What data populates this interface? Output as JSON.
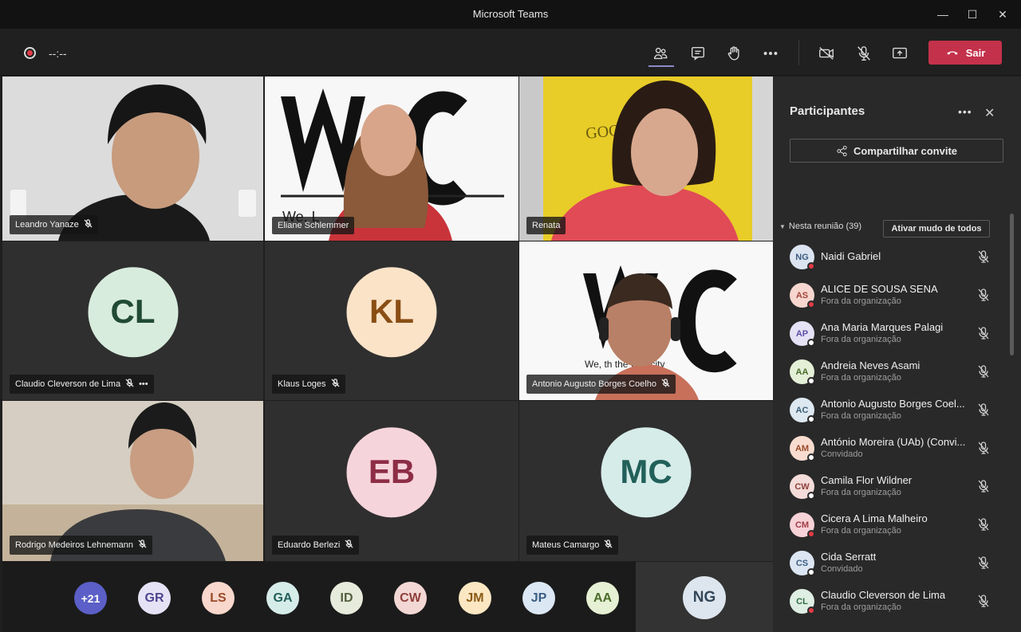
{
  "window": {
    "title": "Microsoft Teams",
    "minimize": "—",
    "maximize": "☐",
    "close": "✕"
  },
  "toolbar": {
    "timer": "--:--",
    "leave_label": "Sair"
  },
  "tiles": {
    "t1": "Leandro Yanaze",
    "t2": "Eliane Schlemmer",
    "t3": "Renata",
    "t4": "Claudio Cleverson de Lima",
    "t4_more": "•••",
    "t4_initials": "CL",
    "t5": "Klaus Loges",
    "t5_initials": "KL",
    "t6": "Antonio Augusto Borges Coelho",
    "t7": "Rodrigo Medeiros Lehnemann",
    "t8": "Eduardo Berlezi",
    "t8_initials": "EB",
    "t9": "Mateus Camargo",
    "t9_initials": "MC",
    "wall_text": "GOOD",
    "wlc_text": "We, L",
    "wlc_text2": "We,        th the Cibricity"
  },
  "strip": [
    "+21",
    "GR",
    "LS",
    "GA",
    "ID",
    "CW",
    "JM",
    "JP",
    "AA"
  ],
  "self_initials": "NG",
  "panel": {
    "title": "Participantes",
    "more": "•••",
    "close": "✕",
    "invite_label": "Compartilhar convite",
    "section_label": "Nesta reunião (39)",
    "muteall_label": "Ativar mudo de todos",
    "people": [
      {
        "initials": "NG",
        "name": "Naidi Gabriel",
        "sub": "",
        "bg": "#dbe4f0",
        "fg": "#3d5a80",
        "dot": "#e23b45"
      },
      {
        "initials": "AS",
        "name": "ALICE DE SOUSA SENA",
        "sub": "Fora da organização",
        "bg": "#f6d6cf",
        "fg": "#a2453a",
        "dot": "#e23b45"
      },
      {
        "initials": "AP",
        "name": "Ana Maria Marques Palagi",
        "sub": "Fora da organização",
        "bg": "#e6e2f6",
        "fg": "#5b4ea8",
        "dot": "#ffffff"
      },
      {
        "initials": "AA",
        "name": "Andreia Neves Asami",
        "sub": "Fora da organização",
        "bg": "#e4efd8",
        "fg": "#4a6b2a",
        "dot": "#ffffff"
      },
      {
        "initials": "AC",
        "name": "Antonio Augusto Borges Coel...",
        "sub": "Fora da organização",
        "bg": "#dde8f0",
        "fg": "#3b6078",
        "dot": "#ffffff"
      },
      {
        "initials": "AM",
        "name": "António Moreira (UAb) (Convi...",
        "sub": "Convidado",
        "bg": "#f8dccf",
        "fg": "#9a4a2a",
        "dot": "#ffffff"
      },
      {
        "initials": "CW",
        "name": "Camila Flor Wildner",
        "sub": "Fora da organização",
        "bg": "#f3dcd9",
        "fg": "#8f3f3a",
        "dot": "#ffffff"
      },
      {
        "initials": "CM",
        "name": "Cicera A Lima Malheiro",
        "sub": "Fora da organização",
        "bg": "#f6d2d6",
        "fg": "#a23a48",
        "dot": "#e23b45"
      },
      {
        "initials": "CS",
        "name": "Cida Serratt",
        "sub": "Convidado",
        "bg": "#dbe6f2",
        "fg": "#3e5d82",
        "dot": "#ffffff"
      },
      {
        "initials": "CL",
        "name": "Claudio Cleverson de Lima",
        "sub": "Fora da organização",
        "bg": "#dfeee2",
        "fg": "#2f6b45",
        "dot": "#e23b45"
      }
    ]
  }
}
